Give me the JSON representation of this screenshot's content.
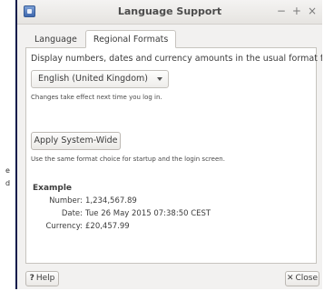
{
  "background": {
    "fragments": [
      "e",
      "d"
    ]
  },
  "window": {
    "title": "Language Support",
    "controls": {
      "minimize": "−",
      "maximize": "+",
      "close": "×"
    }
  },
  "tabs": [
    {
      "label": "Language",
      "active": false
    },
    {
      "label": "Regional Formats",
      "active": true
    }
  ],
  "regional": {
    "intro": "Display numbers, dates and currency amounts in the usual format for:",
    "selected_format": "English (United Kingdom)",
    "change_note": "Changes take effect next time you log in.",
    "apply_button": "Apply System-Wide",
    "apply_note": "Use the same format choice for startup and the login screen.",
    "example": {
      "heading": "Example",
      "rows": [
        {
          "label": "Number:",
          "value": "1,234,567.89"
        },
        {
          "label": "Date:",
          "value": "Tue 26 May 2015 07:38:50 CEST"
        },
        {
          "label": "Currency:",
          "value": "£20,457.99"
        }
      ]
    }
  },
  "footer": {
    "help_icon": "?",
    "help_label": "Help",
    "close_icon": "✕",
    "close_label": "Close"
  }
}
